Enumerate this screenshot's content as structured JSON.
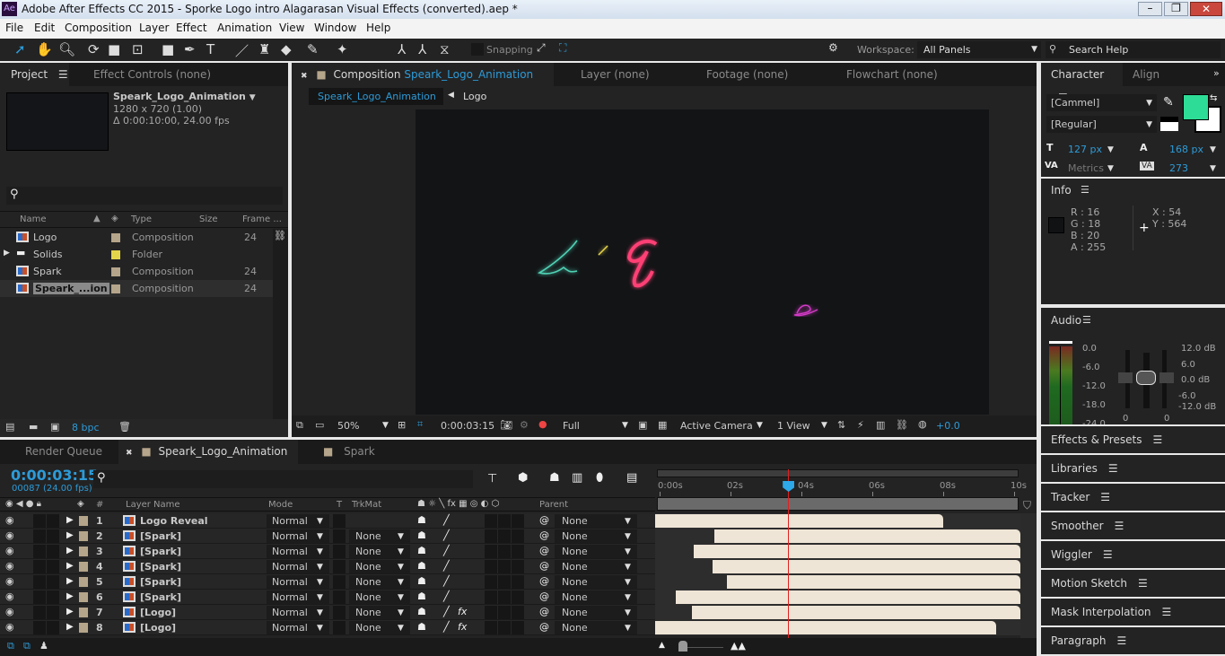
{
  "window": {
    "title": "Adobe After Effects CC 2015 - Sporke Logo intro Alagarasan Visual Effects (converted).aep *",
    "app_icon": "Ae"
  },
  "menu": [
    "File",
    "Edit",
    "Composition",
    "Layer",
    "Effect",
    "Animation",
    "View",
    "Window",
    "Help"
  ],
  "toolbar": {
    "snapping_label": "Snapping",
    "workspace_label": "Workspace:",
    "workspace_value": "All Panels",
    "search_help": "Search Help"
  },
  "project": {
    "tab_label": "Project",
    "effect_controls_tab": "Effect Controls (none)",
    "comp_name": "Speark_Logo_Animation",
    "comp_size": "1280 x 720 (1.00)",
    "comp_duration": "Δ 0:00:10:00, 24.00 fps",
    "columns": [
      "Name",
      "Type",
      "Size",
      "Frame ..."
    ],
    "items": [
      {
        "name": "Logo",
        "type": "Composition",
        "frame": "24",
        "label_color": "#b5a58a",
        "icon": "composition-icon"
      },
      {
        "name": "Solids",
        "type": "Folder",
        "frame": "",
        "label_color": "#e2d54b",
        "icon": "folder-icon"
      },
      {
        "name": "Spark",
        "type": "Composition",
        "frame": "24",
        "label_color": "#b5a58a",
        "icon": "composition-icon"
      },
      {
        "name": "Speark_...ion",
        "type": "Composition",
        "frame": "24",
        "label_color": "#b5a58a",
        "icon": "composition-icon",
        "selected": true
      }
    ],
    "bpc": "8 bpc"
  },
  "composition": {
    "tab_prefix": "Composition",
    "tab_name": "Speark_Logo_Animation",
    "other_tabs": [
      "Layer (none)",
      "Footage (none)",
      "Flowchart (none)"
    ],
    "breadcrumb": [
      "Speark_Logo_Animation",
      "Logo"
    ],
    "footer": {
      "zoom": "50%",
      "timecode": "0:00:03:15",
      "resolution": "Full",
      "camera": "Active Camera",
      "views": "1 View",
      "exposure": "+0.0"
    }
  },
  "character": {
    "tab_label": "Character",
    "align_tab": "Align",
    "font": "[Cammel]",
    "style": "[Regular]",
    "font_size": "127 px",
    "leading": "168 px",
    "kerning": "Metrics",
    "tracking": "273",
    "fill_color": "#2ddc96"
  },
  "info": {
    "title": "Info",
    "r": "R : 16",
    "g": "G : 18",
    "b": "B : 20",
    "a": "A : 255",
    "x": "X : 54",
    "y": "Y : 564"
  },
  "audio": {
    "title": "Audio",
    "left_scale": [
      "0.0",
      "-6.0",
      "-12.0",
      "-18.0",
      "-24.0"
    ],
    "right_scale": [
      "12.0 dB",
      "6.0",
      "0.0 dB",
      "-6.0",
      "-12.0 dB"
    ],
    "slider_labels": [
      "0",
      "0"
    ]
  },
  "collapsed_panels": [
    "Effects & Presets",
    "Libraries",
    "Tracker",
    "Smoother",
    "Wiggler",
    "Motion Sketch",
    "Mask Interpolation",
    "Paragraph"
  ],
  "timeline": {
    "render_queue_tab": "Render Queue",
    "comp_tab": "Speark_Logo_Animation",
    "spark_tab": "Spark",
    "timecode": "0:00:03:15",
    "frame_info": "00087 (24.00 fps)",
    "headers": {
      "num": "#",
      "layer_name": "Layer Name",
      "mode": "Mode",
      "t": "T",
      "trkmat": "TrkMat",
      "parent": "Parent"
    },
    "ruler": [
      "0:00s",
      "02s",
      "04s",
      "06s",
      "08s",
      "10s"
    ],
    "current_time_s": 3.625,
    "duration_s": 10,
    "layers": [
      {
        "num": "1",
        "name": "Logo Reveal",
        "mode": "Normal",
        "trkmat": "",
        "parent": "None",
        "fx": false,
        "in": 0,
        "out": 8.0
      },
      {
        "num": "2",
        "name": "[Spark]",
        "mode": "Normal",
        "trkmat": "None",
        "parent": "None",
        "fx": false,
        "in": 1.55,
        "out": 10
      },
      {
        "num": "3",
        "name": "[Spark]",
        "mode": "Normal",
        "trkmat": "None",
        "parent": "None",
        "fx": false,
        "in": 0.95,
        "out": 10
      },
      {
        "num": "4",
        "name": "[Spark]",
        "mode": "Normal",
        "trkmat": "None",
        "parent": "None",
        "fx": false,
        "in": 1.5,
        "out": 10
      },
      {
        "num": "5",
        "name": "[Spark]",
        "mode": "Normal",
        "trkmat": "None",
        "parent": "None",
        "fx": false,
        "in": 1.9,
        "out": 10
      },
      {
        "num": "6",
        "name": "[Spark]",
        "mode": "Normal",
        "trkmat": "None",
        "parent": "None",
        "fx": false,
        "in": 0.45,
        "out": 10
      },
      {
        "num": "7",
        "name": "[Logo]",
        "mode": "Normal",
        "trkmat": "None",
        "parent": "None",
        "fx": true,
        "in": 0.9,
        "out": 10
      },
      {
        "num": "8",
        "name": "[Logo]",
        "mode": "Normal",
        "trkmat": "None",
        "parent": "None",
        "fx": true,
        "in": 0,
        "out": 9.5
      }
    ]
  }
}
